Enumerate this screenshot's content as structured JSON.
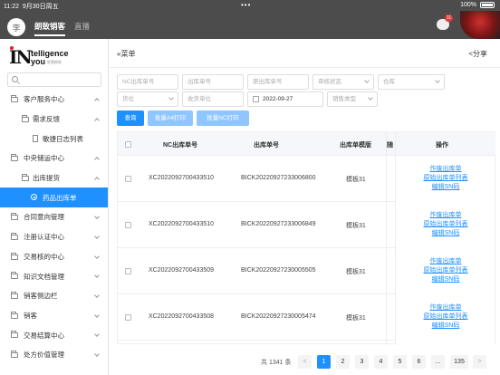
{
  "statusbar": {
    "time": "11:22",
    "date": "9月30日周五",
    "dots": "•••",
    "battery": "100%"
  },
  "header": {
    "avatar_text": "李",
    "tabs": [
      {
        "label": "朗致销客",
        "active": true
      },
      {
        "label": "直播",
        "active": false
      }
    ],
    "chat_badge": "11"
  },
  "sidebar": {
    "logo": {
      "mark": "IN",
      "line1": "telligence",
      "line2": "you",
      "sub": "智慧朗致"
    },
    "search_placeholder": "Q",
    "items": [
      {
        "label": "客户服务中心",
        "expanded": true
      },
      {
        "label": "需求反馈",
        "expanded": true
      },
      {
        "label": "敏捷日志列表"
      },
      {
        "label": "中央储运中心",
        "expanded": true
      },
      {
        "label": "出库提货",
        "expanded": true
      },
      {
        "label": "药品出库单",
        "active": true
      },
      {
        "label": "合同意向管理"
      },
      {
        "label": "注册认证中心"
      },
      {
        "label": "交易核的中心"
      },
      {
        "label": "知识文档管理"
      },
      {
        "label": "销客侧边栏"
      },
      {
        "label": "销客"
      },
      {
        "label": "交易结算中心"
      },
      {
        "label": "处方价值管理"
      }
    ]
  },
  "main": {
    "menu_toggle": "«菜单",
    "share": "<分享",
    "filters": {
      "nc_no": "NC出库单号",
      "out_no": "出库单号",
      "orig_no": "原出库单号",
      "audit": "审核状态",
      "warehouse": "仓库",
      "cargo_pos": "货位",
      "receipt_pos": "收货单位",
      "date": "2022-09-27",
      "sale_type": "销售类型"
    },
    "buttons": {
      "query": "查询",
      "batch_a4": "批量A4打印",
      "batch_nc": "批量NC打印"
    },
    "table": {
      "headers": {
        "nc_no": "NC出库单号",
        "out_no": "出库单号",
        "template": "出库单模版",
        "extra": "随",
        "ops": "操作"
      },
      "rows": [
        {
          "nc_no": "XC2022092700433510",
          "out_no": "BICK20220927233006800",
          "template": "模板31"
        },
        {
          "nc_no": "XC2022092700433510",
          "out_no": "BICK20220927233006849",
          "template": "模板31"
        },
        {
          "nc_no": "XC2022092700433509",
          "out_no": "BICK20220927230005505",
          "template": "模板31"
        },
        {
          "nc_no": "XC2022092700433508",
          "out_no": "BICK20220927230005474",
          "template": "模板31"
        }
      ],
      "ops": {
        "void": "作废出库单",
        "orig_list": "原始出库单列表",
        "edit_sn": "编辑SN码"
      }
    },
    "pagination": {
      "total": "共 1341 条",
      "pages": [
        "1",
        "2",
        "3",
        "4",
        "5",
        "6",
        "...",
        "135"
      ],
      "current": "1",
      "prev": "<",
      "next": ">"
    }
  }
}
